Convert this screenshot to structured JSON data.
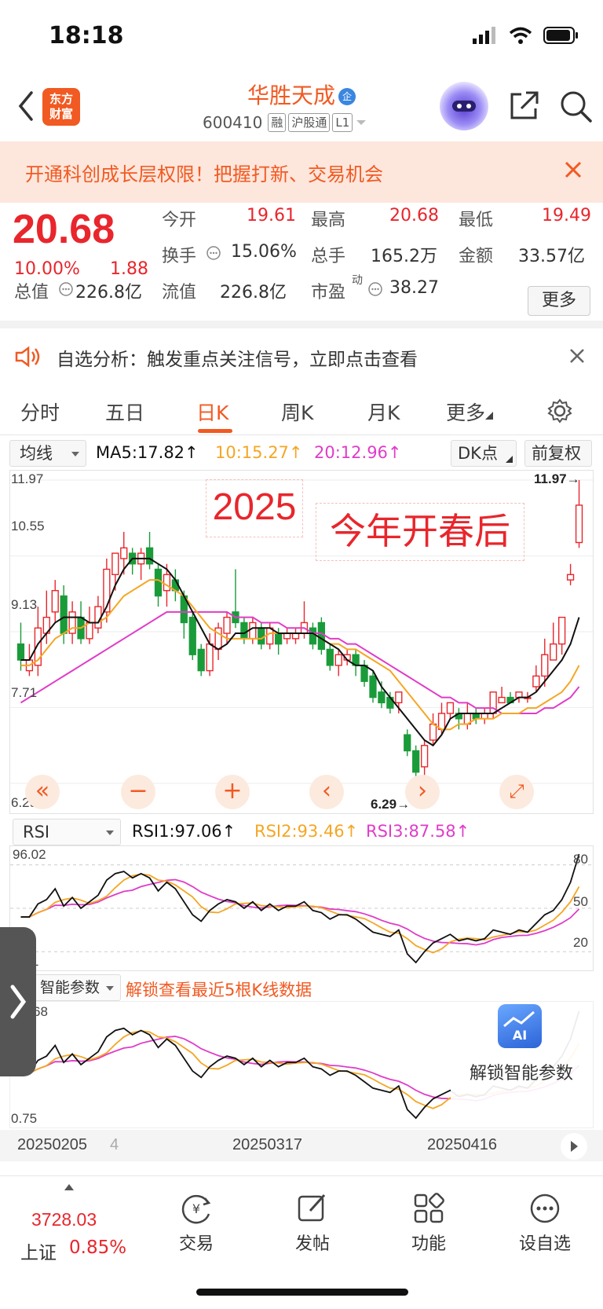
{
  "status": {
    "time": "18:18"
  },
  "nav": {
    "brand_logo": "东方\n财富",
    "stock_name": "华胜天成",
    "verified_badge": "企",
    "stock_code": "600410",
    "tags": [
      "融",
      "沪股通",
      "L1"
    ]
  },
  "promo": {
    "text": "开通科创成长层权限！把握打新、交易机会"
  },
  "quote": {
    "price": "20.68",
    "change_pct": "10.00%",
    "change_abs": "1.88",
    "open_label": "今开",
    "open": "19.61",
    "high_label": "最高",
    "high": "20.68",
    "low_label": "最低",
    "low": "19.49",
    "turnover_label": "换手",
    "turnover": "15.06%",
    "volume_label": "总手",
    "volume": "165.2万",
    "amount_label": "金额",
    "amount": "33.57亿",
    "mktcap_label": "总值",
    "mktcap": "226.8亿",
    "float_label": "流值",
    "float_cap": "226.8亿",
    "pe_label": "市盈",
    "pe_sup": "动",
    "pe": "38.27",
    "more": "更多"
  },
  "notice": {
    "text": "自选分析：触发重点关注信号，立即点击查看"
  },
  "tabs": [
    "分时",
    "五日",
    "日K",
    "周K",
    "月K",
    "更多"
  ],
  "active_tab": "日K",
  "main_indicator": {
    "select": "均线",
    "ma5": "MA5:17.82↑",
    "ma10": "10:15.27↑",
    "ma20": "20:12.96↑",
    "dk": "DK点",
    "adjust": "前复权",
    "colors": {
      "ma5": "#111111",
      "ma10": "#f5a623",
      "ma20": "#e03cc8",
      "up": "#e8262c",
      "down": "#1a9b3a"
    }
  },
  "price_axis": [
    "11.97",
    "10.55",
    "9.13",
    "7.71",
    "6.29"
  ],
  "annotations": {
    "year": "2025",
    "caption": "今年开春后",
    "max_marker": "11.97→",
    "min_marker": "6.29→"
  },
  "rsi": {
    "select": "RSI",
    "rsi1": "RSI1:97.06↑",
    "rsi2": "RSI2:93.46↑",
    "rsi3": "RSI3:87.58↑",
    "top": "96.02",
    "bottom": "1",
    "levels": [
      "80",
      "50",
      "20"
    ]
  },
  "smart": {
    "select": "智能参数",
    "unlock_text": "解锁查看最近5根K线数据",
    "top": "68",
    "bottom": "0.75",
    "card_label": "解锁智能参数",
    "card_icon": "AI"
  },
  "dates": [
    "20250205",
    "4",
    "20250317",
    "20250416"
  ],
  "bottom_bar": {
    "index_value": "3728.03",
    "index_name": "上证",
    "index_pct": "0.85%",
    "items": [
      "交易",
      "发帖",
      "功能",
      "设自选"
    ]
  },
  "chart_data": {
    "type": "candlestick",
    "ylim": [
      6.29,
      11.97
    ],
    "candles": [
      [
        8.9,
        8.6,
        9.3,
        8.4
      ],
      [
        8.4,
        8.6,
        8.9,
        8.3
      ],
      [
        8.5,
        9.2,
        9.6,
        8.3
      ],
      [
        9.1,
        9.4,
        9.9,
        8.9
      ],
      [
        9.5,
        9.9,
        10.1,
        9.3
      ],
      [
        9.8,
        9.1,
        10.0,
        8.9
      ],
      [
        9.1,
        9.5,
        9.7,
        8.9
      ],
      [
        9.4,
        9.0,
        9.7,
        8.9
      ],
      [
        9.0,
        9.3,
        9.6,
        8.9
      ],
      [
        9.2,
        9.6,
        9.8,
        9.1
      ],
      [
        9.5,
        10.3,
        10.5,
        9.3
      ],
      [
        10.2,
        10.6,
        10.6,
        9.9
      ],
      [
        10.5,
        10.7,
        11.0,
        10.2
      ],
      [
        10.6,
        10.4,
        10.7,
        10.2
      ],
      [
        10.4,
        10.6,
        10.7,
        10.1
      ],
      [
        10.7,
        10.4,
        11.0,
        10.3
      ],
      [
        10.3,
        9.8,
        10.4,
        9.6
      ],
      [
        9.9,
        10.2,
        10.4,
        9.6
      ],
      [
        10.1,
        9.9,
        10.3,
        9.7
      ],
      [
        9.8,
        9.3,
        9.9,
        9.0
      ],
      [
        9.4,
        8.7,
        9.5,
        8.6
      ],
      [
        8.8,
        8.4,
        8.9,
        8.3
      ],
      [
        8.4,
        8.9,
        9.1,
        8.3
      ],
      [
        8.8,
        9.2,
        9.3,
        8.6
      ],
      [
        9.1,
        9.4,
        9.5,
        8.9
      ],
      [
        9.5,
        9.3,
        10.3,
        9.2
      ],
      [
        9.3,
        9.0,
        9.4,
        8.9
      ],
      [
        9.0,
        9.3,
        9.4,
        8.9
      ],
      [
        9.2,
        8.9,
        9.3,
        8.8
      ],
      [
        8.9,
        9.2,
        9.3,
        8.8
      ],
      [
        9.1,
        8.9,
        9.2,
        8.7
      ],
      [
        9.0,
        9.1,
        9.2,
        8.9
      ],
      [
        9.0,
        9.1,
        9.2,
        8.9
      ],
      [
        9.1,
        9.3,
        9.7,
        9.0
      ],
      [
        9.2,
        8.9,
        9.3,
        8.8
      ],
      [
        9.3,
        8.8,
        9.4,
        8.7
      ],
      [
        8.8,
        8.5,
        8.9,
        8.4
      ],
      [
        8.5,
        8.7,
        8.8,
        8.3
      ],
      [
        8.6,
        8.7,
        8.8,
        8.5
      ],
      [
        8.7,
        8.5,
        8.8,
        8.3
      ],
      [
        8.5,
        8.2,
        8.6,
        8.1
      ],
      [
        8.3,
        7.9,
        8.4,
        7.8
      ],
      [
        8.0,
        7.8,
        8.2,
        7.7
      ],
      [
        7.9,
        7.7,
        8.0,
        7.6
      ],
      [
        7.8,
        8.0,
        8.0,
        7.6
      ],
      [
        7.2,
        6.9,
        7.3,
        6.8
      ],
      [
        6.9,
        6.5,
        7.0,
        6.3
      ],
      [
        6.6,
        7.0,
        7.1,
        6.3
      ],
      [
        7.1,
        7.4,
        7.6,
        7.0
      ],
      [
        7.3,
        7.6,
        7.8,
        7.2
      ],
      [
        7.6,
        7.8,
        7.8,
        7.5
      ],
      [
        7.6,
        7.5,
        7.7,
        7.3
      ],
      [
        7.4,
        7.6,
        7.8,
        7.3
      ],
      [
        7.6,
        7.5,
        7.7,
        7.4
      ],
      [
        7.5,
        7.6,
        7.7,
        7.4
      ],
      [
        7.6,
        8.0,
        8.0,
        7.5
      ],
      [
        7.8,
        7.9,
        8.1,
        7.8
      ],
      [
        7.9,
        7.8,
        8.0,
        7.8
      ],
      [
        7.9,
        8.0,
        8.0,
        7.8
      ],
      [
        7.9,
        7.9,
        8.0,
        7.8
      ],
      [
        8.1,
        8.3,
        8.5,
        8.0
      ],
      [
        8.3,
        8.7,
        9.0,
        8.1
      ],
      [
        8.6,
        8.9,
        9.3,
        8.6
      ],
      [
        8.9,
        9.4,
        9.4,
        8.7
      ],
      [
        10.1,
        10.2,
        10.4,
        10.0
      ],
      [
        10.8,
        11.5,
        11.97,
        10.7
      ]
    ],
    "ma5": [
      8.6,
      8.6,
      8.9,
      9.1,
      9.3,
      9.4,
      9.4,
      9.4,
      9.3,
      9.3,
      9.6,
      10.0,
      10.3,
      10.5,
      10.5,
      10.5,
      10.4,
      10.3,
      10.1,
      9.8,
      9.5,
      9.2,
      8.9,
      8.8,
      8.9,
      9.1,
      9.1,
      9.2,
      9.2,
      9.2,
      9.1,
      9.1,
      9.1,
      9.1,
      9.1,
      9.0,
      8.9,
      8.8,
      8.6,
      8.5,
      8.5,
      8.4,
      8.1,
      7.9,
      7.7,
      7.5,
      7.3,
      7.1,
      7.0,
      7.2,
      7.5,
      7.6,
      7.6,
      7.6,
      7.6,
      7.6,
      7.7,
      7.8,
      7.9,
      7.9,
      8.0,
      8.2,
      8.4,
      8.6,
      8.9,
      9.4
    ],
    "ma10": [
      8.5,
      8.5,
      8.6,
      8.8,
      9.0,
      9.1,
      9.2,
      9.2,
      9.3,
      9.3,
      9.4,
      9.6,
      9.8,
      9.9,
      10.0,
      10.1,
      10.1,
      10.0,
      9.9,
      9.8,
      9.6,
      9.4,
      9.2,
      9.1,
      9.0,
      9.0,
      9.0,
      9.0,
      9.0,
      9.1,
      9.1,
      9.1,
      9.1,
      9.1,
      9.1,
      9.0,
      8.9,
      8.9,
      8.8,
      8.8,
      8.7,
      8.6,
      8.5,
      8.4,
      8.2,
      8.0,
      7.8,
      7.6,
      7.4,
      7.3,
      7.3,
      7.4,
      7.4,
      7.5,
      7.5,
      7.5,
      7.6,
      7.6,
      7.6,
      7.7,
      7.7,
      7.8,
      7.9,
      8.0,
      8.2,
      8.5
    ],
    "ma20": [
      7.8,
      7.9,
      8.0,
      8.1,
      8.2,
      8.3,
      8.4,
      8.5,
      8.6,
      8.7,
      8.8,
      8.9,
      9.0,
      9.1,
      9.2,
      9.3,
      9.4,
      9.5,
      9.5,
      9.5,
      9.5,
      9.5,
      9.5,
      9.5,
      9.5,
      9.4,
      9.4,
      9.4,
      9.3,
      9.3,
      9.3,
      9.2,
      9.2,
      9.2,
      9.1,
      9.1,
      9.0,
      9.0,
      8.9,
      8.9,
      8.8,
      8.7,
      8.6,
      8.5,
      8.4,
      8.3,
      8.2,
      8.1,
      8.0,
      7.9,
      7.9,
      7.8,
      7.8,
      7.7,
      7.7,
      7.7,
      7.6,
      7.6,
      7.6,
      7.6,
      7.6,
      7.7,
      7.7,
      7.8,
      7.9,
      8.1
    ]
  }
}
